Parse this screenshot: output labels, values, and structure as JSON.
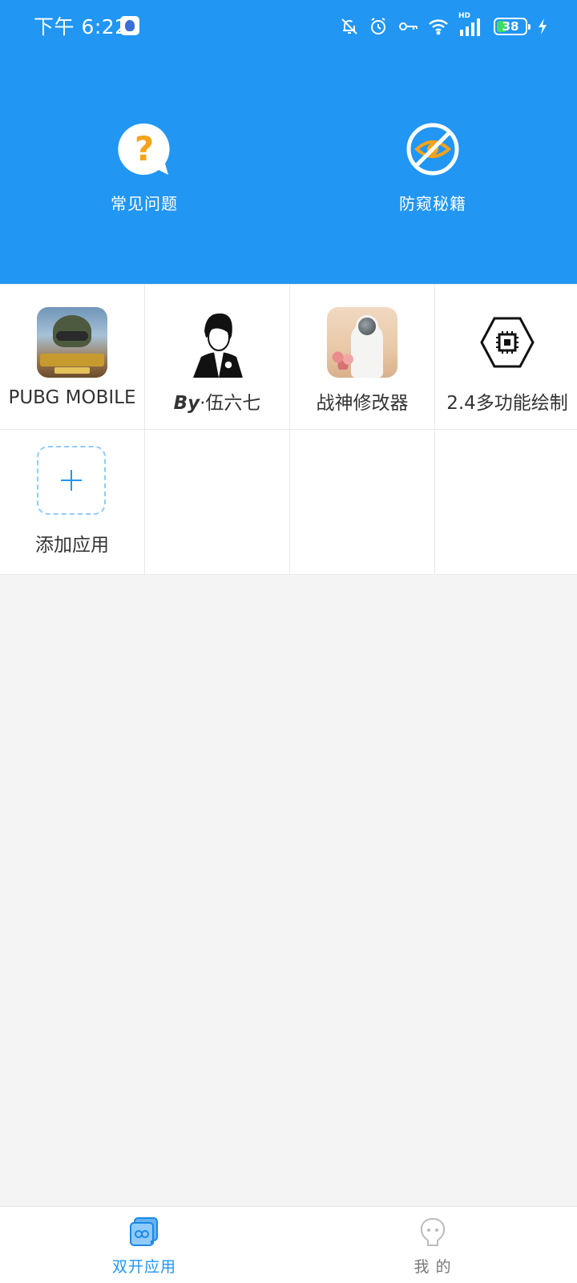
{
  "status_bar": {
    "time": "下午 6:22",
    "battery_level": "38",
    "network_badge": "HD"
  },
  "header": {
    "background_color": "#2196f3",
    "actions": [
      {
        "label": "常见问题",
        "icon": "question-bubble-icon"
      },
      {
        "label": "防窥秘籍",
        "icon": "eye-slash-icon"
      }
    ]
  },
  "apps": [
    {
      "label": "PUBG MOBILE",
      "icon": "pubg-mobile-icon"
    },
    {
      "label_prefix": "By",
      "label_suffix": "·伍六七",
      "icon": "avatar-icon"
    },
    {
      "label": "战神修改器",
      "icon": "astronaut-icon"
    },
    {
      "label": "2.4多功能绘制",
      "icon": "chip-hexagon-icon"
    },
    {
      "label": "添加应用",
      "icon": "add-icon"
    }
  ],
  "bottom_nav": {
    "items": [
      {
        "label": "双开应用",
        "active": true,
        "icon": "dual-apps-icon"
      },
      {
        "label": "我 的",
        "active": false,
        "icon": "profile-icon"
      }
    ],
    "active_color": "#2196f3"
  }
}
